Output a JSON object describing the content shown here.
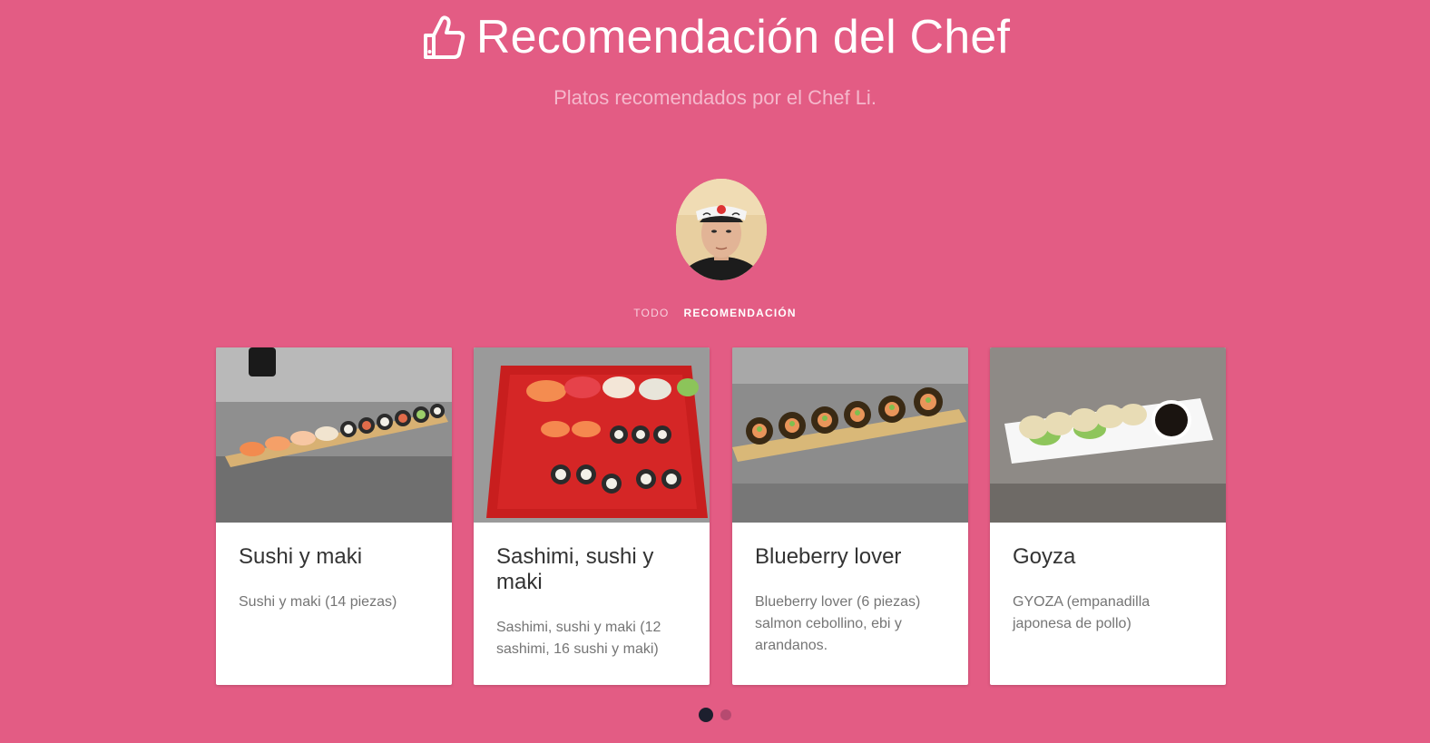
{
  "header": {
    "icon": "thumbs-up-icon",
    "title": "Recomendación del Chef",
    "subtitle": "Platos recomendados por el Chef Li."
  },
  "avatar": {
    "alt": "Chef Li"
  },
  "filters": [
    {
      "label": "TODO",
      "active": false
    },
    {
      "label": "RECOMENDACIÓN",
      "active": true
    }
  ],
  "cards": [
    {
      "title": "Sushi y maki",
      "description": "Sushi y maki (14 piezas)"
    },
    {
      "title": "Sashimi, sushi y maki",
      "description": "Sashimi, sushi y maki (12 sashimi, 16 sushi y maki)"
    },
    {
      "title": "Blueberry lover",
      "description": "Blueberry lover (6 piezas) salmon cebollino, ebi y arandanos."
    },
    {
      "title": "Goyza",
      "description": "GYOZA (empanadilla japonesa de pollo)"
    }
  ],
  "pagination": {
    "count": 2,
    "active_index": 0
  },
  "colors": {
    "background": "#e35c84",
    "card": "#ffffff",
    "dot_active": "#1d1f2e",
    "dot_inactive": "#b64a70"
  }
}
